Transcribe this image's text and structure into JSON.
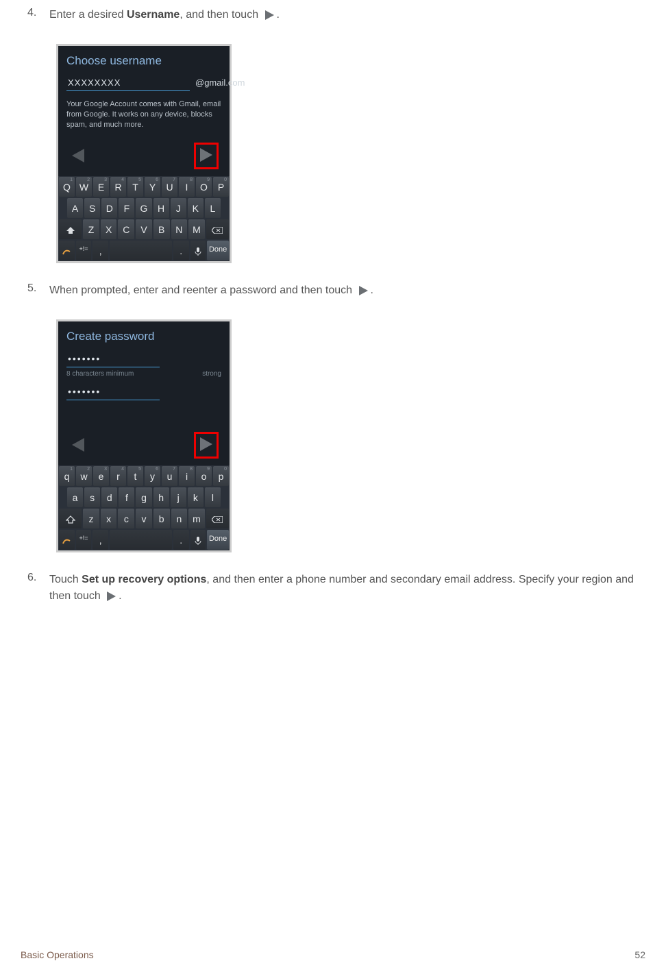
{
  "steps": {
    "s4": {
      "num": "4.",
      "pre": "Enter a desired ",
      "bold": "Username",
      "post": ", and then touch ",
      "end": "."
    },
    "s5": {
      "num": "5.",
      "text": "When prompted, enter and reenter a password and then touch ",
      "end": "."
    },
    "s6": {
      "num": "6.",
      "pre": "Touch ",
      "bold": "Set up recovery options",
      "post": ", and then enter a phone number and secondary email address. Specify your region and then touch ",
      "end": "."
    }
  },
  "phone1": {
    "title": "Choose username",
    "input": "XXXXXXXX",
    "domain": "@gmail.com",
    "desc": "Your Google Account comes with Gmail, email from Google. It works on any device, blocks spam, and much more."
  },
  "phone2": {
    "title": "Create password",
    "pw": "•••••••",
    "hint": "8 characters minimum",
    "strength": "strong",
    "confirm": "•••••••"
  },
  "keyboard": {
    "row1u": [
      "Q",
      "W",
      "E",
      "R",
      "T",
      "Y",
      "U",
      "I",
      "O",
      "P"
    ],
    "row2u": [
      "A",
      "S",
      "D",
      "F",
      "G",
      "H",
      "J",
      "K",
      "L"
    ],
    "row3u": [
      "Z",
      "X",
      "C",
      "V",
      "B",
      "N",
      "M"
    ],
    "row1l": [
      "q",
      "w",
      "e",
      "r",
      "t",
      "y",
      "u",
      "i",
      "o",
      "p"
    ],
    "row2l": [
      "a",
      "s",
      "d",
      "f",
      "g",
      "h",
      "j",
      "k",
      "l"
    ],
    "row3l": [
      "z",
      "x",
      "c",
      "v",
      "b",
      "n",
      "m"
    ],
    "sym": "+!=",
    "comma": ",",
    "period": ".",
    "done": "Done"
  },
  "footer": {
    "section": "Basic Operations",
    "page": "52"
  }
}
